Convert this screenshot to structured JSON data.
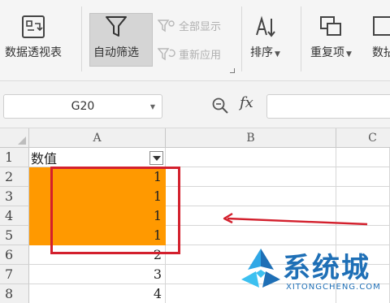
{
  "ribbon": {
    "pivot_label": "数据透视表",
    "autofilter_label": "自动筛选",
    "show_all_label": "全部显示",
    "reapply_label": "重新应用",
    "sort_label": "排序",
    "duplicates_label": "重复项",
    "data_label_partial": "数拈"
  },
  "formula_bar": {
    "name_box": "G20",
    "fx_symbol": "fx",
    "formula": ""
  },
  "sheet": {
    "columns": [
      "A",
      "B",
      "C"
    ],
    "rows": [
      "1",
      "2",
      "3",
      "4",
      "5",
      "6",
      "7",
      "8"
    ],
    "header_cell": "数值",
    "values": [
      "1",
      "1",
      "1",
      "1",
      "2",
      "3",
      "4"
    ]
  },
  "colors": {
    "highlight": "#ff9900",
    "annotation_red": "#d3202d",
    "watermark_blue": "#1e6fb6"
  },
  "watermark": {
    "title": "系统城",
    "subtitle": "XITONGCHENG.COM"
  }
}
